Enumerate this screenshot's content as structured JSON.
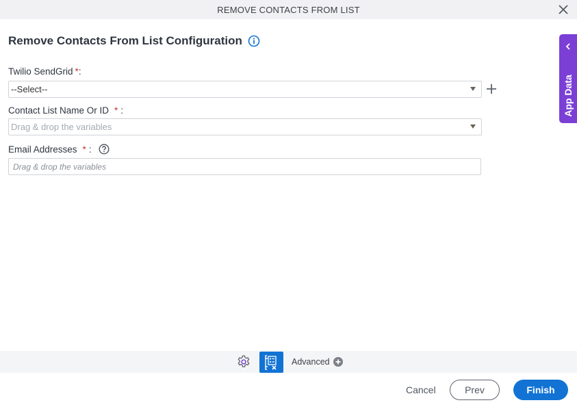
{
  "window": {
    "title": "REMOVE CONTACTS FROM LIST",
    "close_icon": "close-icon"
  },
  "form": {
    "heading": "Remove Contacts From List Configuration",
    "heading_icon": "info-icon",
    "fields": [
      {
        "label": "Twilio SendGrid",
        "required_mark": "*",
        "suffix": ":",
        "type": "select",
        "value": "--Select--",
        "add_icon": "plus-icon"
      },
      {
        "label": "Contact List Name Or ID",
        "required_mark": "*",
        "suffix": ":",
        "type": "select",
        "placeholder": "Drag & drop the variables"
      },
      {
        "label": "Email Addresses",
        "required_mark": "*",
        "suffix": ":",
        "type": "text",
        "placeholder": "Drag & drop the variables",
        "help_icon": "help-icon"
      }
    ]
  },
  "side_panel": {
    "label": "App Data",
    "icon": "chevron-left-icon",
    "color": "#7b3fd6"
  },
  "advanced_bar": {
    "gear_icon": "gear-icon",
    "variable_icon": "variable-mapping-icon",
    "advanced_label": "Advanced",
    "advanced_icon": "plus-circle-icon"
  },
  "footer": {
    "cancel_label": "Cancel",
    "prev_label": "Prev",
    "finish_label": "Finish",
    "accent": "#1273d4"
  }
}
